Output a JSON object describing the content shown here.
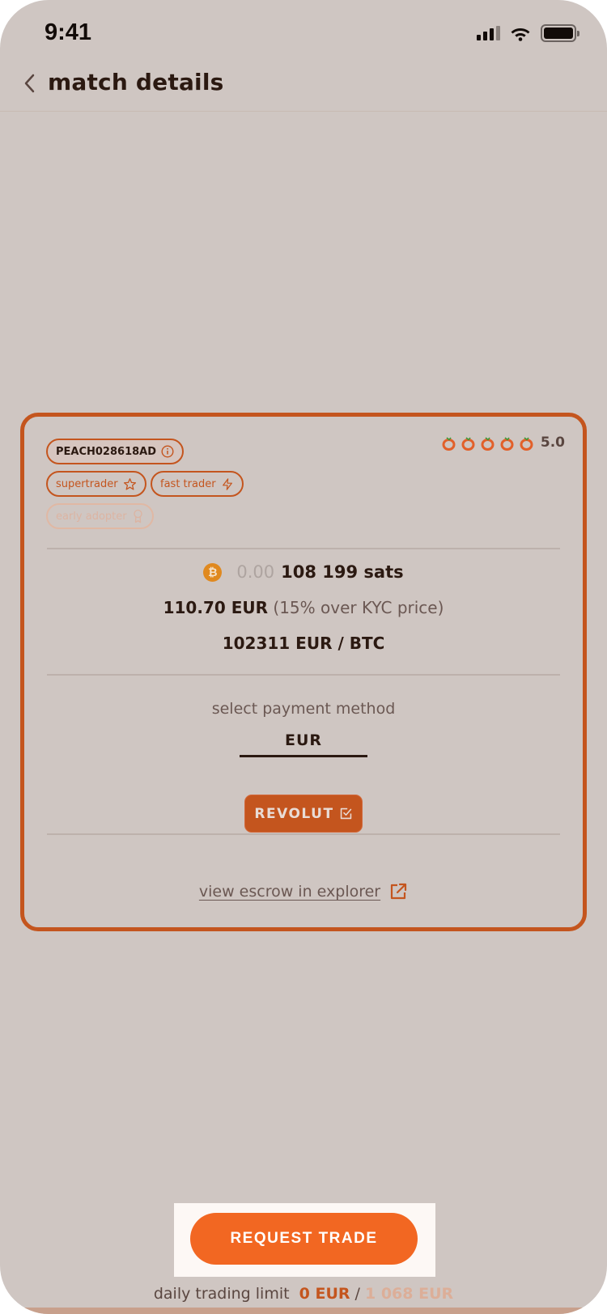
{
  "status_bar": {
    "time": "9:41"
  },
  "header": {
    "title": "match details",
    "back_icon": "chevron-left-icon"
  },
  "offer": {
    "user_id": "PEACH028618AD",
    "badges": [
      {
        "label": "supertrader",
        "icon": "star-icon",
        "active": true
      },
      {
        "label": "fast trader",
        "icon": "lightning-icon",
        "active": true
      },
      {
        "label": "early adopter",
        "icon": "award-icon",
        "active": false
      }
    ],
    "rating": {
      "value": "5.0",
      "peaches": 5
    },
    "amount": {
      "btc_prefix": "0.00",
      "sats": "108 199 sats"
    },
    "price": {
      "eur": "110.70 EUR",
      "premium": "(15% over KYC price)"
    },
    "rate": "102311 EUR / BTC",
    "payment": {
      "label": "select payment method",
      "currency": "EUR",
      "method": "REVOLUT"
    },
    "explorer_link": "view escrow in explorer"
  },
  "cta": {
    "label": "REQUEST TRADE"
  },
  "daily_limit": {
    "label": "daily trading limit",
    "used": "0 EUR",
    "separator": "/",
    "max": "1 068 EUR"
  },
  "colors": {
    "brand": "#c4551e",
    "cta": "#f26722",
    "background": "#cfc6c2",
    "text": "#2b1911"
  }
}
